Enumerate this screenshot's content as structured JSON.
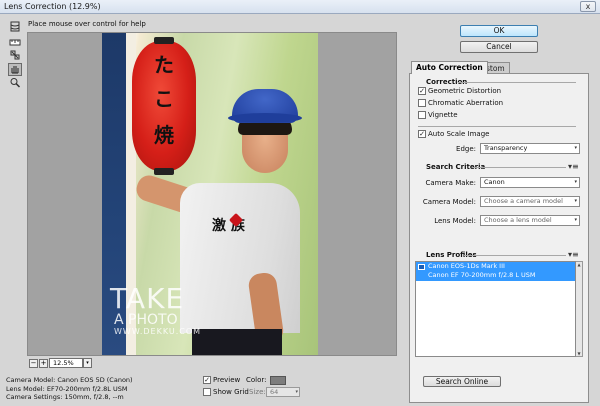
{
  "window": {
    "title": "Lens Correction (12.9%)",
    "close_glyph": "x"
  },
  "help_text": "Place mouse over control for help",
  "tools": [
    "remove-distortion-tool",
    "straighten-tool",
    "move-grid-tool",
    "hand-tool",
    "zoom-tool"
  ],
  "photo": {
    "lantern_text": [
      "た",
      "こ",
      "焼"
    ],
    "shirt_text": "激 族",
    "watermark_line1": "TAKE",
    "watermark_line2": "A PHOTO",
    "watermark_line3": "WWW.DEKKU.COM"
  },
  "zoom": {
    "minus": "−",
    "plus": "+",
    "value": "12.5%",
    "dropdown": "▾"
  },
  "info": {
    "camera_model": "Camera Model: Canon EOS 5D (Canon)",
    "lens_model": "Lens Model: EF70-200mm f/2.8L USM",
    "camera_settings": "Camera Settings: 150mm, f/2.8, --m"
  },
  "options": {
    "preview_label": "Preview",
    "preview_checked": true,
    "show_grid_label": "Show Grid",
    "show_grid_checked": false,
    "color_label": "Color:",
    "color_value": "#7d7d7d",
    "size_label": "Size:",
    "size_value": "64"
  },
  "buttons": {
    "ok": "OK",
    "cancel": "Cancel",
    "search_online": "Search Online"
  },
  "tabs": [
    {
      "label": "Auto Correction",
      "active": true
    },
    {
      "label": "Custom",
      "active": false
    }
  ],
  "correction": {
    "heading": "Correction",
    "geometric_distortion": "Geometric Distortion",
    "geometric_checked": true,
    "chromatic_aberration": "Chromatic Aberration",
    "chromatic_checked": false,
    "vignette": "Vignette",
    "vignette_checked": false,
    "auto_scale": "Auto Scale Image",
    "auto_scale_checked": true,
    "edge_label": "Edge:",
    "edge_value": "Transparency"
  },
  "search_criteria": {
    "heading": "Search Criteria",
    "camera_make_label": "Camera Make:",
    "camera_make_value": "Canon",
    "camera_model_label": "Camera Model:",
    "camera_model_value": "Choose a camera model",
    "lens_model_label": "Lens Model:",
    "lens_model_value": "Choose a lens model"
  },
  "lens_profiles": {
    "heading": "Lens Profiles",
    "selected_line1": "Canon EOS-1Ds Mark III",
    "selected_line2": "Canon EF 70-200mm f/2.8 L USM"
  },
  "icons": {
    "panel_menu": "▾≡",
    "dropdown_arrow": "▾",
    "check": "✓"
  }
}
